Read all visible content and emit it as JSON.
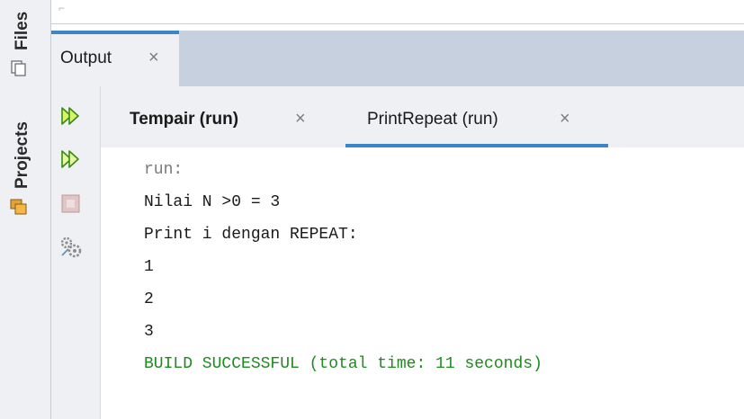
{
  "sidebar": {
    "tabs": [
      {
        "label": "Files",
        "icon": "files-icon"
      },
      {
        "label": "Projects",
        "icon": "projects-icon"
      }
    ]
  },
  "output_window": {
    "tab_label": "Output",
    "close_glyph": "×"
  },
  "controls": [
    {
      "icon": "rerun-icon"
    },
    {
      "icon": "rerun-with-args-icon"
    },
    {
      "icon": "stop-icon"
    },
    {
      "icon": "settings-icon"
    }
  ],
  "run_tabs": [
    {
      "label": "Tempair (run)",
      "close_glyph": "×",
      "bold": true
    },
    {
      "label": "PrintRepeat (run)",
      "close_glyph": "×",
      "bold": false
    }
  ],
  "console": {
    "lines": [
      {
        "text": "run:",
        "color": "#7a7a7a"
      },
      {
        "text": "Nilai N >0 = 3",
        "color": "#1a1a1a"
      },
      {
        "text": "Print i dengan REPEAT:",
        "color": "#1a1a1a"
      },
      {
        "text": "1",
        "color": "#1a1a1a"
      },
      {
        "text": "2",
        "color": "#1a1a1a"
      },
      {
        "text": "3",
        "color": "#1a1a1a"
      },
      {
        "text": "BUILD SUCCESSFUL (total time: 11 seconds)",
        "color": "#1f8a1f"
      }
    ]
  },
  "colors": {
    "accent": "#3a86c8",
    "panel": "#eef0f3",
    "header_bar": "#c6d0df",
    "success": "#1f8a1f"
  }
}
